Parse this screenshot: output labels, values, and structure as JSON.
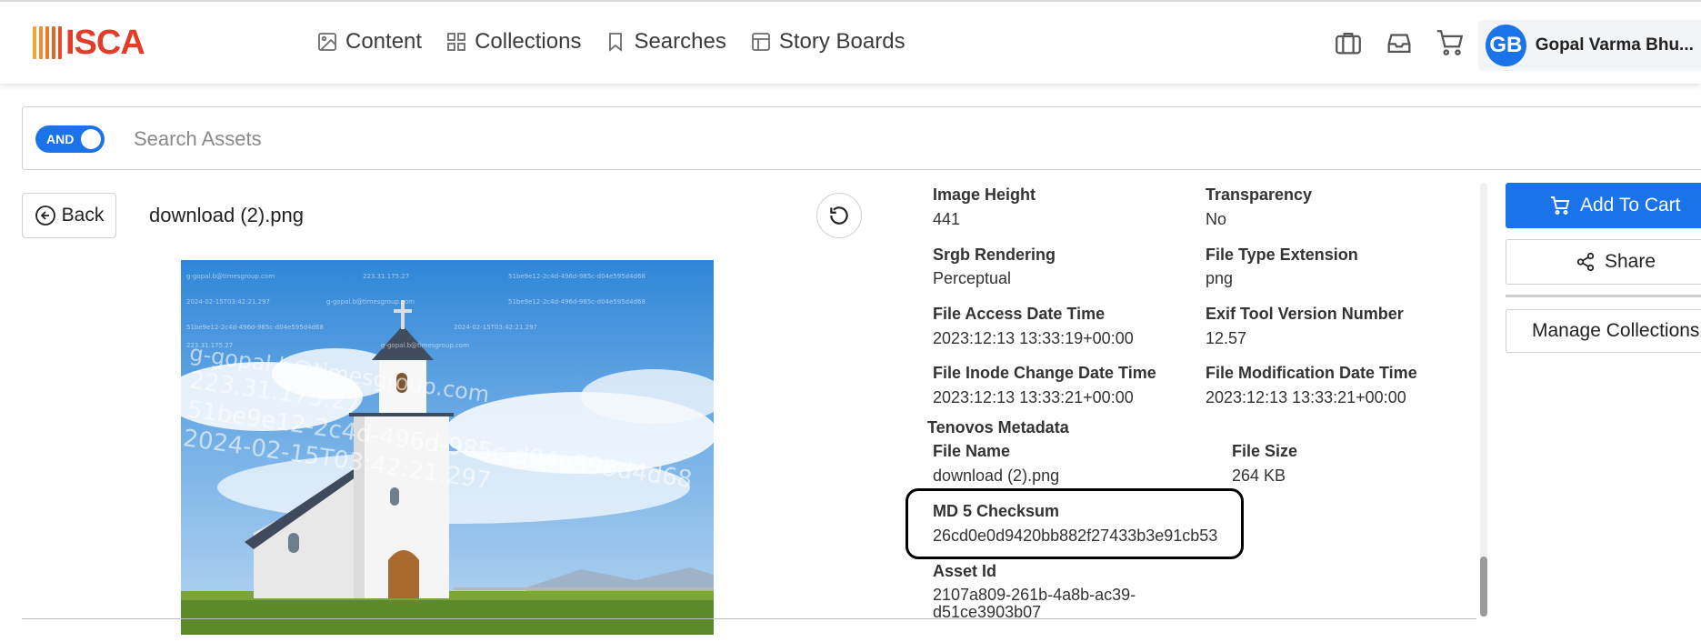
{
  "brand": {
    "logo_text": "ISCA",
    "bar_colors": [
      "#f2a33a",
      "#ef8d2f",
      "#ec7a2a",
      "#e96626",
      "#e55024"
    ]
  },
  "nav": {
    "items": [
      {
        "label": "Content",
        "icon": "image-icon"
      },
      {
        "label": "Collections",
        "icon": "grid-icon"
      },
      {
        "label": "Searches",
        "icon": "bookmark-icon"
      },
      {
        "label": "Story Boards",
        "icon": "layout-icon"
      }
    ]
  },
  "header_icons": [
    "briefcase-icon",
    "inbox-icon",
    "cart-icon"
  ],
  "user": {
    "initials": "GB",
    "name": "Gopal Varma Bhu..."
  },
  "search": {
    "toggle_label": "AND",
    "placeholder": "Search Assets"
  },
  "asset": {
    "back_label": "Back",
    "file_name": "download (2).png",
    "watermark_lines": [
      "g-gopal.b@timesgroup.com",
      "223.31.175.27",
      "51be9e12-2c4d-496d-985c-d04e595d4d68",
      "2024-02-15T03:42:21.297"
    ]
  },
  "metadata": {
    "image_height_label": "Image Height",
    "image_height": "441",
    "transparency_label": "Transparency",
    "transparency": "No",
    "srgb_label": "Srgb Rendering",
    "srgb": "Perceptual",
    "file_ext_label": "File Type Extension",
    "file_ext": "png",
    "access_label": "File Access Date Time",
    "access": "2023:12:13 13:33:19+00:00",
    "exif_label": "Exif Tool Version Number",
    "exif": "12.57",
    "inode_label": "File Inode Change Date Time",
    "inode": "2023:12:13 13:33:21+00:00",
    "mod_label": "File Modification Date Time",
    "mod": "2023:12:13 13:33:21+00:00"
  },
  "tenovos": {
    "title": "Tenovos Metadata",
    "file_name_label": "File Name",
    "file_name": "download (2).png",
    "file_size_label": "File Size",
    "file_size": "264 KB",
    "md5_label": "MD 5 Checksum",
    "md5": "26cd0e0d9420bb882f27433b3e91cb53",
    "asset_id_label": "Asset Id",
    "asset_id_line1": "2107a809-261b-4a8b-ac39-",
    "asset_id_line2": "d51ce3903b07"
  },
  "actions": {
    "add_to_cart": "Add To Cart",
    "share": "Share",
    "manage_collections": "Manage Collections"
  },
  "colors": {
    "primary": "#1a73e8",
    "brand_red": "#e33d2a"
  }
}
